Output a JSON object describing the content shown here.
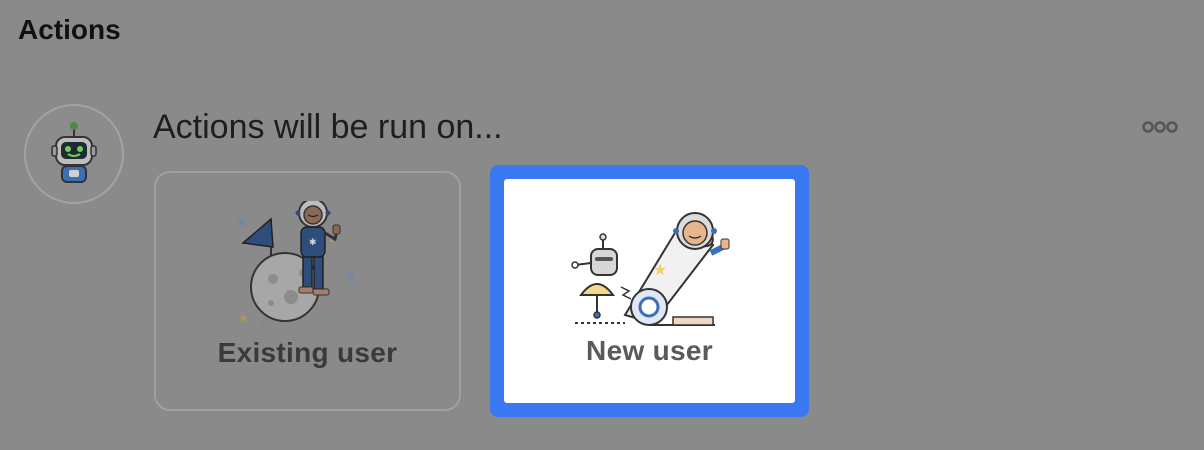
{
  "section": {
    "title": "Actions"
  },
  "bot_avatar": {
    "icon": "robot-icon"
  },
  "prompt": {
    "text": "Actions will be run on..."
  },
  "more_menu": {
    "icon": "more-dots-icon"
  },
  "options": [
    {
      "label": "Existing user",
      "icon": "astronaut-on-moon-icon",
      "selected": false
    },
    {
      "label": "New user",
      "icon": "astronaut-cannon-icon",
      "selected": true
    }
  ],
  "colors": {
    "selection_accent": "#3a78f2",
    "overlay": "#8a8a8a"
  }
}
